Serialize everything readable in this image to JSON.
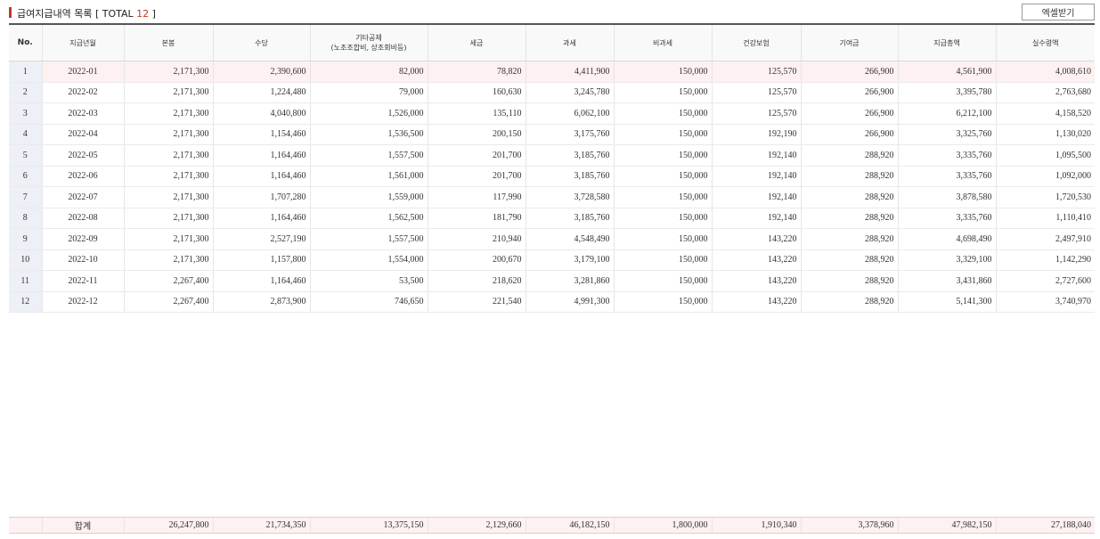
{
  "header": {
    "title_prefix": "급여지급내역 목록 [ TOTAL ",
    "total_count": "12",
    "title_suffix": " ]",
    "excel_button": "엑셀받기"
  },
  "columns": [
    "No.",
    "지급년월",
    "본봉",
    "수당",
    "기타공제",
    "(노조조합비, 상조회비등)",
    "세금",
    "과세",
    "비과세",
    "건강보험",
    "기여금",
    "지급총액",
    "실수령액"
  ],
  "rows": [
    [
      "1",
      "2022-01",
      "2,171,300",
      "2,390,600",
      "82,000",
      "78,820",
      "4,411,900",
      "150,000",
      "125,570",
      "266,900",
      "4,561,900",
      "4,008,610"
    ],
    [
      "2",
      "2022-02",
      "2,171,300",
      "1,224,480",
      "79,000",
      "160,630",
      "3,245,780",
      "150,000",
      "125,570",
      "266,900",
      "3,395,780",
      "2,763,680"
    ],
    [
      "3",
      "2022-03",
      "2,171,300",
      "4,040,800",
      "1,526,000",
      "135,110",
      "6,062,100",
      "150,000",
      "125,570",
      "266,900",
      "6,212,100",
      "4,158,520"
    ],
    [
      "4",
      "2022-04",
      "2,171,300",
      "1,154,460",
      "1,536,500",
      "200,150",
      "3,175,760",
      "150,000",
      "192,190",
      "266,900",
      "3,325,760",
      "1,130,020"
    ],
    [
      "5",
      "2022-05",
      "2,171,300",
      "1,164,460",
      "1,557,500",
      "201,700",
      "3,185,760",
      "150,000",
      "192,140",
      "288,920",
      "3,335,760",
      "1,095,500"
    ],
    [
      "6",
      "2022-06",
      "2,171,300",
      "1,164,460",
      "1,561,000",
      "201,700",
      "3,185,760",
      "150,000",
      "192,140",
      "288,920",
      "3,335,760",
      "1,092,000"
    ],
    [
      "7",
      "2022-07",
      "2,171,300",
      "1,707,280",
      "1,559,000",
      "117,990",
      "3,728,580",
      "150,000",
      "192,140",
      "288,920",
      "3,878,580",
      "1,720,530"
    ],
    [
      "8",
      "2022-08",
      "2,171,300",
      "1,164,460",
      "1,562,500",
      "181,790",
      "3,185,760",
      "150,000",
      "192,140",
      "288,920",
      "3,335,760",
      "1,110,410"
    ],
    [
      "9",
      "2022-09",
      "2,171,300",
      "2,527,190",
      "1,557,500",
      "210,940",
      "4,548,490",
      "150,000",
      "143,220",
      "288,920",
      "4,698,490",
      "2,497,910"
    ],
    [
      "10",
      "2022-10",
      "2,171,300",
      "1,157,800",
      "1,554,000",
      "200,670",
      "3,179,100",
      "150,000",
      "143,220",
      "288,920",
      "3,329,100",
      "1,142,290"
    ],
    [
      "11",
      "2022-11",
      "2,267,400",
      "1,164,460",
      "53,500",
      "218,620",
      "3,281,860",
      "150,000",
      "143,220",
      "288,920",
      "3,431,860",
      "2,727,600"
    ],
    [
      "12",
      "2022-12",
      "2,267,400",
      "2,873,900",
      "746,650",
      "221,540",
      "4,991,300",
      "150,000",
      "143,220",
      "288,920",
      "5,141,300",
      "3,740,970"
    ]
  ],
  "totals": [
    "",
    "합계",
    "26,247,800",
    "21,734,350",
    "13,375,150",
    "2,129,660",
    "46,182,150",
    "1,800,000",
    "1,910,340",
    "3,378,960",
    "47,982,150",
    "27,188,040"
  ]
}
